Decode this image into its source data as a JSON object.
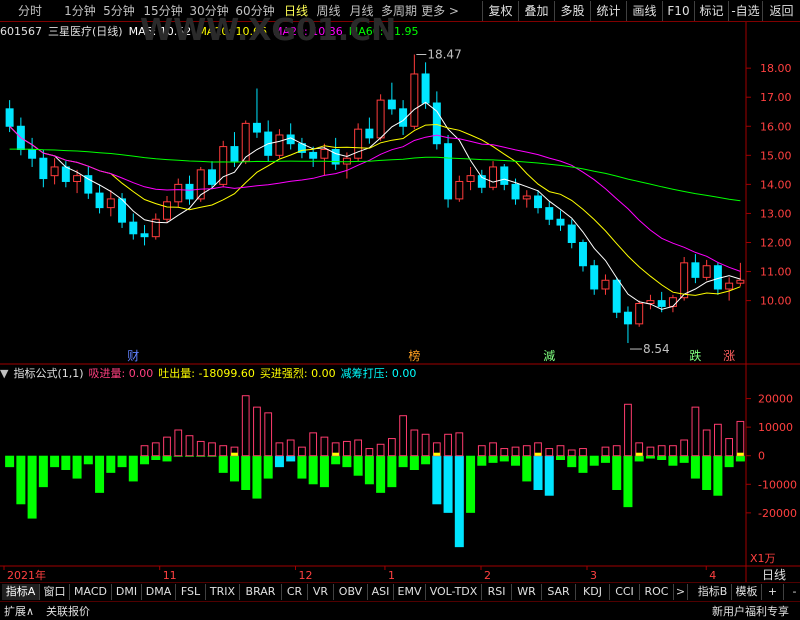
{
  "periods": [
    "分时",
    "1分钟",
    "5分钟",
    "15分钟",
    "30分钟",
    "60分钟",
    "日线",
    "周线",
    "月线",
    "多周期",
    "更多 >"
  ],
  "active_period": "日线",
  "right_buttons": [
    "复权",
    "叠加",
    "多股",
    "统计",
    "画线",
    "F10",
    "标记",
    "-自选",
    "返回"
  ],
  "stock": {
    "code": "601567",
    "name": "三星医疗(日线)"
  },
  "ma": {
    "ma5": {
      "label": "MA5: 10.52",
      "color": "#ffffff"
    },
    "ma10": {
      "label": "MA10: 10.66",
      "color": "#ffff00"
    },
    "ma20": {
      "label": "MA20: 10.36",
      "color": "#ff00ff"
    },
    "ma60": {
      "label": "MA60: 11.95",
      "color": "#00ff00"
    }
  },
  "indicator": {
    "name": "指标公式(1,1)",
    "items": [
      {
        "label": "吸进量: 0.00",
        "color": "#ff4080"
      },
      {
        "label": "吐出量: -18099.60",
        "color": "#ffff00"
      },
      {
        "label": "买进强烈: 0.00",
        "color": "#ffff00"
      },
      {
        "label": "减筹打压: 0.00",
        "color": "#00ffff"
      }
    ]
  },
  "markers": [
    {
      "text": "财",
      "color": "#6080ff"
    },
    {
      "text": "榜",
      "color": "#ffa020"
    },
    {
      "text": "減",
      "color": "#80ff80"
    },
    {
      "text": "跌",
      "color": "#80ff80"
    },
    {
      "text": "涨",
      "color": "#ff6060"
    }
  ],
  "price_annotations": {
    "high": "18.47",
    "low": "8.54"
  },
  "watermark": "WWW.XG01.CN",
  "unit_label": "X1万",
  "period_footer": "日线",
  "x_labels": [
    "2021年",
    "11",
    "12",
    "1",
    "2",
    "3",
    "4"
  ],
  "bottom_tabs": [
    "指标A",
    "窗口",
    "MACD",
    "DMI",
    "DMA",
    "FSL",
    "TRIX",
    "BRAR",
    "CR",
    "VR",
    "OBV",
    "ASI",
    "EMV",
    "VOL-TDX",
    "RSI",
    "WR",
    "SAR",
    "KDJ",
    "CCI",
    "ROC",
    ">",
    "指标B",
    "模板",
    "+",
    "-"
  ],
  "status": {
    "expand": "扩展∧",
    "linked": "关联报价",
    "promo": "新用户福利专享"
  },
  "chart_data": {
    "type": "candlestick",
    "price_ticks": [
      "18.00",
      "17.00",
      "16.00",
      "15.00",
      "14.00",
      "13.00",
      "12.00",
      "11.00",
      "10.00"
    ],
    "price_ylim": [
      8.3,
      18.9
    ],
    "ma_period": [
      5,
      10,
      20,
      60
    ],
    "candles_ohlc": [
      [
        16.6,
        16.9,
        15.8,
        16.0
      ],
      [
        16.0,
        16.3,
        15.0,
        15.2
      ],
      [
        15.2,
        15.6,
        14.6,
        14.9
      ],
      [
        14.9,
        15.2,
        13.9,
        14.2
      ],
      [
        14.3,
        14.9,
        14.0,
        14.6
      ],
      [
        14.6,
        14.8,
        13.9,
        14.1
      ],
      [
        14.1,
        14.5,
        13.7,
        14.3
      ],
      [
        14.3,
        14.6,
        13.5,
        13.7
      ],
      [
        13.7,
        14.0,
        13.0,
        13.2
      ],
      [
        13.2,
        13.8,
        12.9,
        13.5
      ],
      [
        13.5,
        13.7,
        12.5,
        12.7
      ],
      [
        12.7,
        13.0,
        12.1,
        12.3
      ],
      [
        12.3,
        12.6,
        11.9,
        12.2
      ],
      [
        12.2,
        13.0,
        12.1,
        12.8
      ],
      [
        12.8,
        13.6,
        12.7,
        13.4
      ],
      [
        13.4,
        14.2,
        13.2,
        14.0
      ],
      [
        14.0,
        14.3,
        13.3,
        13.5
      ],
      [
        13.5,
        14.6,
        13.4,
        14.5
      ],
      [
        14.5,
        14.8,
        13.9,
        14.0
      ],
      [
        14.0,
        15.5,
        13.9,
        15.3
      ],
      [
        15.3,
        15.8,
        14.6,
        14.8
      ],
      [
        14.8,
        16.2,
        14.7,
        16.1
      ],
      [
        16.1,
        17.3,
        15.6,
        15.8
      ],
      [
        15.8,
        16.2,
        14.8,
        15.0
      ],
      [
        15.0,
        15.9,
        14.9,
        15.7
      ],
      [
        15.7,
        16.1,
        15.2,
        15.4
      ],
      [
        15.4,
        15.6,
        14.9,
        15.1
      ],
      [
        15.1,
        15.3,
        14.6,
        14.9
      ],
      [
        14.9,
        15.4,
        14.3,
        15.2
      ],
      [
        15.2,
        15.6,
        14.5,
        14.7
      ],
      [
        14.7,
        15.1,
        14.2,
        14.9
      ],
      [
        14.9,
        16.1,
        14.8,
        15.9
      ],
      [
        15.9,
        16.3,
        15.4,
        15.6
      ],
      [
        15.6,
        17.1,
        15.5,
        16.9
      ],
      [
        16.9,
        17.5,
        16.4,
        16.6
      ],
      [
        16.6,
        16.9,
        15.7,
        16.0
      ],
      [
        16.0,
        18.47,
        15.9,
        17.8
      ],
      [
        17.8,
        18.2,
        16.6,
        16.8
      ],
      [
        16.8,
        17.2,
        15.2,
        15.4
      ],
      [
        15.4,
        15.7,
        13.2,
        13.5
      ],
      [
        13.5,
        14.3,
        13.4,
        14.1
      ],
      [
        14.1,
        14.6,
        13.8,
        14.3
      ],
      [
        14.3,
        14.5,
        13.7,
        13.9
      ],
      [
        13.9,
        14.8,
        13.8,
        14.6
      ],
      [
        14.6,
        14.7,
        13.8,
        14.0
      ],
      [
        14.0,
        14.2,
        13.3,
        13.5
      ],
      [
        13.5,
        13.8,
        13.2,
        13.6
      ],
      [
        13.6,
        13.8,
        13.0,
        13.2
      ],
      [
        13.2,
        13.4,
        12.6,
        12.8
      ],
      [
        12.8,
        13.1,
        12.4,
        12.6
      ],
      [
        12.6,
        12.8,
        11.8,
        12.0
      ],
      [
        12.0,
        12.1,
        11.0,
        11.2
      ],
      [
        11.2,
        11.4,
        10.2,
        10.4
      ],
      [
        10.4,
        10.9,
        10.2,
        10.7
      ],
      [
        10.7,
        10.8,
        9.4,
        9.6
      ],
      [
        9.6,
        9.8,
        8.54,
        9.2
      ],
      [
        9.2,
        10.0,
        9.1,
        9.9
      ],
      [
        9.9,
        10.2,
        9.7,
        10.0
      ],
      [
        10.0,
        10.3,
        9.6,
        9.8
      ],
      [
        9.8,
        10.2,
        9.6,
        10.1
      ],
      [
        10.1,
        11.5,
        10.0,
        11.3
      ],
      [
        11.3,
        11.6,
        10.6,
        10.8
      ],
      [
        10.8,
        11.4,
        10.7,
        11.2
      ],
      [
        11.2,
        11.3,
        10.2,
        10.4
      ],
      [
        10.4,
        10.8,
        10.0,
        10.6
      ],
      [
        10.6,
        11.3,
        10.5,
        10.7
      ]
    ],
    "indicator_ticks": [
      "20000",
      "10000",
      "0",
      "-10000",
      "-20000"
    ],
    "indicator_ylim": [
      -33000,
      26500
    ],
    "indicator_bars": [
      -4000,
      -17000,
      -22000,
      -11000,
      -4000,
      -5000,
      -8000,
      -3000,
      -13000,
      -6000,
      -4000,
      -9000,
      -3000,
      -1500,
      -2000,
      5000,
      8000,
      4000,
      3000,
      -6000,
      -9000,
      -12000,
      -15000,
      -8000,
      -4000,
      -2000,
      -8000,
      -10000,
      -11000,
      -3000,
      -4000,
      -7000,
      -10000,
      -13000,
      -11000,
      -4000,
      -5000,
      -3000,
      -17000,
      -20000,
      -32000,
      -20000,
      -3500,
      -2500,
      -2000,
      -3500,
      -9000,
      -12000,
      -14000,
      -1500,
      -4000,
      -6000,
      -3500,
      -2500,
      -12000,
      -18000,
      -2000,
      -1000,
      -1500,
      -3500,
      -2500,
      -8000,
      -12000,
      -14000,
      -4000,
      -2000
    ],
    "indicator_pos_bars": [
      0,
      0,
      0,
      0,
      0,
      0,
      0,
      0,
      0,
      0,
      0,
      0,
      3500,
      4500,
      6500,
      9000,
      7000,
      5000,
      4500,
      3500,
      3000,
      21000,
      17000,
      15000,
      4500,
      5500,
      3000,
      8000,
      6500,
      4500,
      5000,
      5500,
      2500,
      4000,
      6000,
      14000,
      9000,
      7500,
      4500,
      7500,
      8000,
      0,
      3500,
      4500,
      2500,
      3000,
      3500,
      4500,
      2500,
      3500,
      2000,
      2500,
      0,
      3000,
      3500,
      18000,
      4500,
      3000,
      3500,
      3500,
      5500,
      17000,
      9000,
      11000,
      6000,
      12000
    ]
  }
}
